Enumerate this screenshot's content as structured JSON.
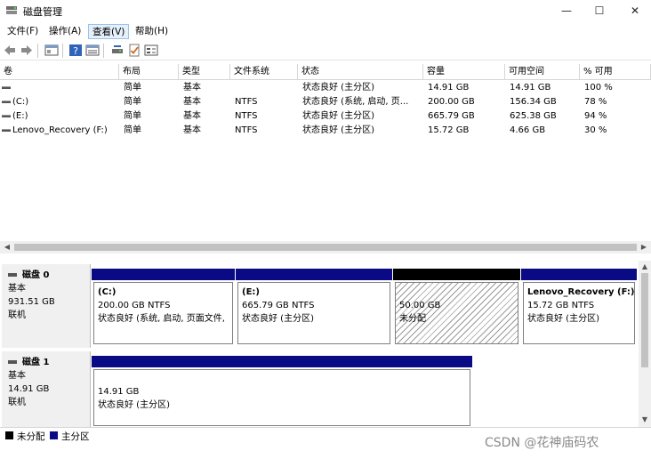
{
  "window": {
    "title": "磁盘管理",
    "minimize": "—",
    "maximize": "☐",
    "close": "✕"
  },
  "menu": [
    {
      "label": "文件(F)"
    },
    {
      "label": "操作(A)"
    },
    {
      "label": "查看(V)"
    },
    {
      "label": "帮助(H)"
    }
  ],
  "columns": [
    "卷",
    "布局",
    "类型",
    "文件系统",
    "状态",
    "容量",
    "可用空间",
    "% 可用"
  ],
  "volumes": [
    {
      "name": "",
      "layout": "简单",
      "type": "基本",
      "fs": "",
      "status": "状态良好 (主分区)",
      "capacity": "14.91 GB",
      "free": "14.91 GB",
      "pct": "100 %"
    },
    {
      "name": "(C:)",
      "layout": "简单",
      "type": "基本",
      "fs": "NTFS",
      "status": "状态良好 (系统, 启动, 页...",
      "capacity": "200.00 GB",
      "free": "156.34 GB",
      "pct": "78 %"
    },
    {
      "name": "(E:)",
      "layout": "简单",
      "type": "基本",
      "fs": "NTFS",
      "status": "状态良好 (主分区)",
      "capacity": "665.79 GB",
      "free": "625.38 GB",
      "pct": "94 %"
    },
    {
      "name": "Lenovo_Recovery (F:)",
      "layout": "简单",
      "type": "基本",
      "fs": "NTFS",
      "status": "状态良好 (主分区)",
      "capacity": "15.72 GB",
      "free": "4.66 GB",
      "pct": "30 %"
    }
  ],
  "disk0": {
    "name": "磁盘 0",
    "kind": "基本",
    "size": "931.51 GB",
    "state": "联机",
    "partitions": [
      {
        "label": "(C:)",
        "line1": "200.00 GB NTFS",
        "line2": "状态良好 (系统, 启动, 页面文件,"
      },
      {
        "label": "(E:)",
        "line1": "665.79 GB NTFS",
        "line2": "状态良好 (主分区)"
      },
      {
        "label": "",
        "line1": "50.00 GB",
        "line2": "未分配"
      },
      {
        "label": "Lenovo_Recovery  (F:)",
        "line1": "15.72 GB NTFS",
        "line2": "状态良好 (主分区)"
      }
    ]
  },
  "disk1": {
    "name": "磁盘 1",
    "kind": "基本",
    "size": "14.91 GB",
    "state": "联机",
    "partitions": [
      {
        "line1": "14.91 GB",
        "line2": "状态良好 (主分区)"
      }
    ]
  },
  "legend": {
    "unallocated": "未分配",
    "primary": "主分区"
  },
  "watermark": "CSDN @花神庙码农",
  "colors": {
    "primary": "#0a0a84",
    "unallocated": "#000000",
    "menu_active": "#e5f0fb"
  }
}
